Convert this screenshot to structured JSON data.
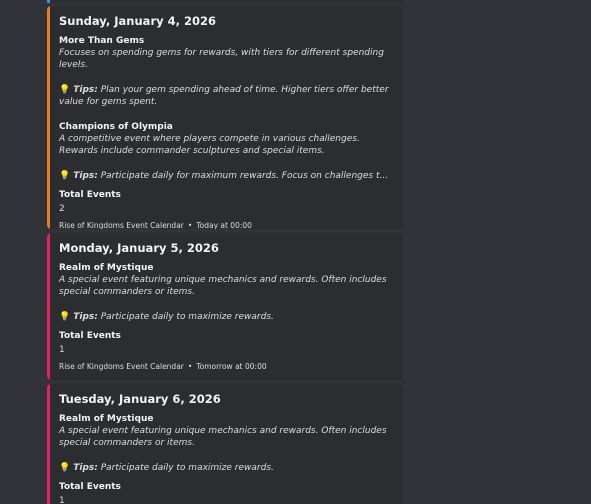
{
  "colors": {
    "background": "#313338",
    "embed_background": "#2b2d31",
    "previous_bar": "#3498db",
    "bar_jan4": "#e67e22",
    "bar_jan5": "#e91e63",
    "bar_jan6": "#e91e63"
  },
  "tip_label": "Tips:",
  "embeds": [
    {
      "title": "Sunday, January 4, 2026",
      "events": [
        {
          "name": "More Than Gems",
          "description": "Focuses on spending gems for rewards, with tiers for different spending levels.",
          "tip": "Plan your gem spending ahead of time. Higher tiers offer better value for gems spent."
        },
        {
          "name": "Champions of Olympia",
          "description": "A competitive event where players compete in various challenges. Rewards include commander sculptures and special items.",
          "tip": "Participate daily for maximum rewards. Focus on challenges t..."
        }
      ],
      "total_label": "Total Events",
      "total_value": "2",
      "footer_source": "Rise of Kingdoms Event Calendar",
      "footer_time": "Today at 00:00"
    },
    {
      "title": "Monday, January 5, 2026",
      "events": [
        {
          "name": "Realm of Mystique",
          "description": "A special event featuring unique mechanics and rewards. Often includes special commanders or items.",
          "tip": "Participate daily to maximize rewards."
        }
      ],
      "total_label": "Total Events",
      "total_value": "1",
      "footer_source": "Rise of Kingdoms Event Calendar",
      "footer_time": "Tomorrow at 00:00"
    },
    {
      "title": "Tuesday, January 6, 2026",
      "events": [
        {
          "name": "Realm of Mystique",
          "description": "A special event featuring unique mechanics and rewards. Often includes special commanders or items.",
          "tip": "Participate daily to maximize rewards."
        }
      ],
      "total_label": "Total Events",
      "total_value": "1"
    }
  ]
}
